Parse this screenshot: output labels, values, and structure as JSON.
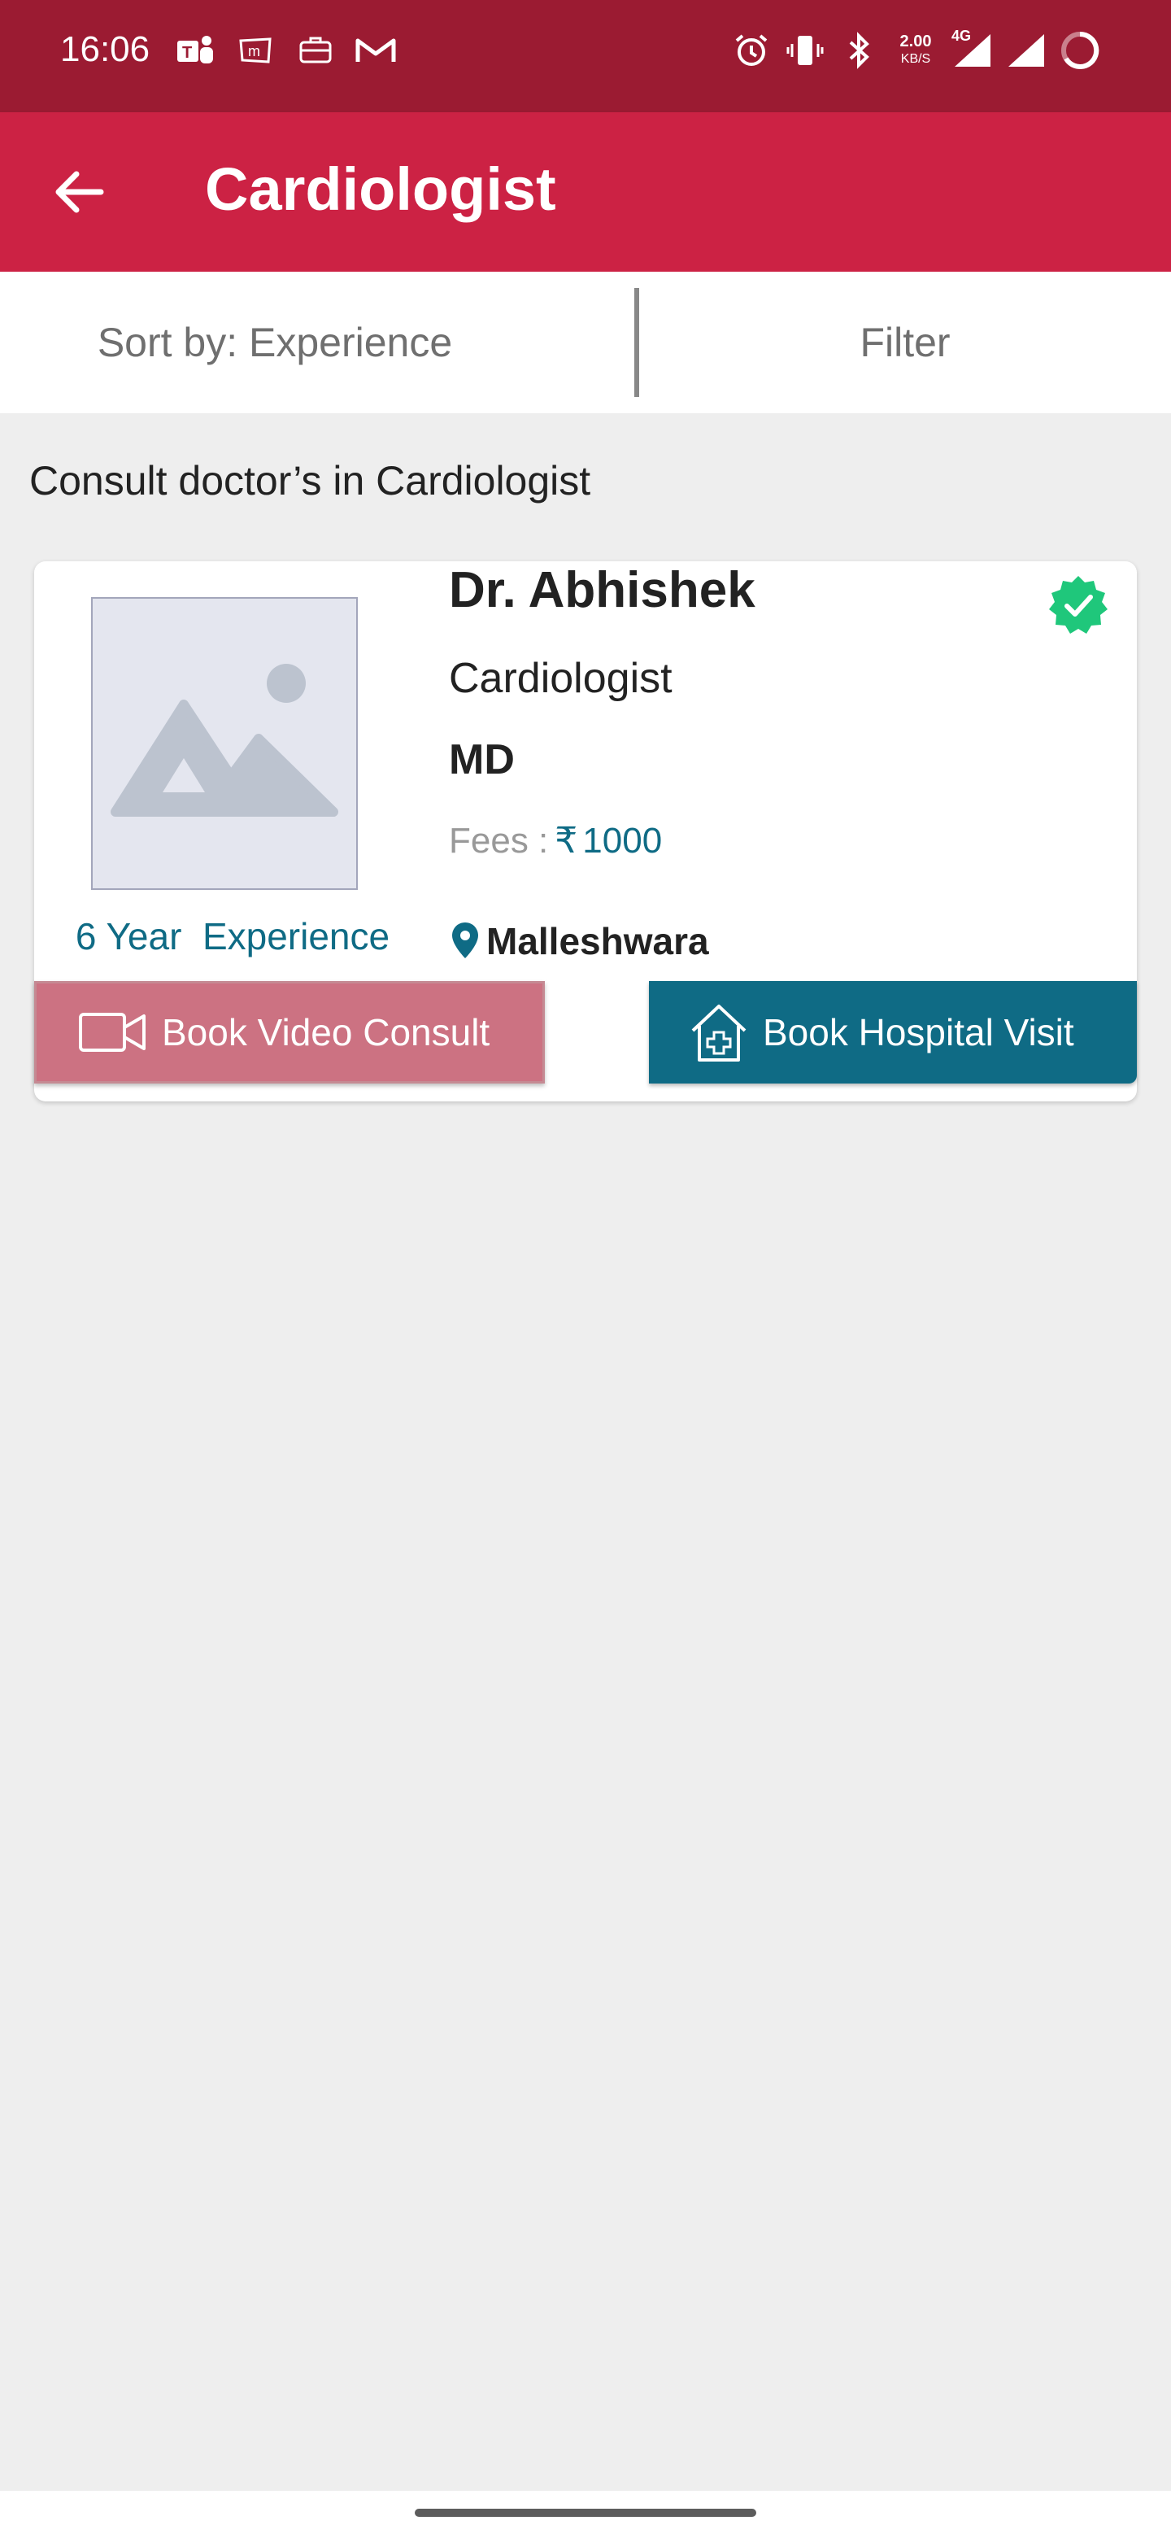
{
  "status_bar": {
    "time": "16:06",
    "notification_icons": [
      "teams-icon",
      "m-app-icon",
      "briefcase-icon",
      "gmail-icon"
    ],
    "system_icons": [
      "alarm-icon",
      "vibrate-icon",
      "bluetooth-icon",
      "network-speed",
      "signal-4g-icon",
      "signal-icon",
      "battery-ring-icon"
    ],
    "network_speed": "2.00",
    "network_speed_unit": "KB/S",
    "network_type": "4G"
  },
  "app_bar": {
    "title": "Cardiologist",
    "color": "#cc2244",
    "status_color": "#9b1b32"
  },
  "sort_bar": {
    "sort_label": "Sort by: Experience",
    "filter_label": "Filter"
  },
  "section_title": "Consult doctor’s in Cardiologist",
  "doctor": {
    "name": "Dr. Abhishek",
    "specialty": "Cardiologist",
    "degree": "MD",
    "fees_label": "Fees :",
    "currency": "₹",
    "fees_amount": "1000",
    "experience": "6 Year  Experience",
    "location": "Malleshwara",
    "verified": true,
    "accent_color": "#0f6b85"
  },
  "actions": {
    "video_label": "Book Video Consult",
    "hospital_label": "Book Hospital Visit"
  }
}
